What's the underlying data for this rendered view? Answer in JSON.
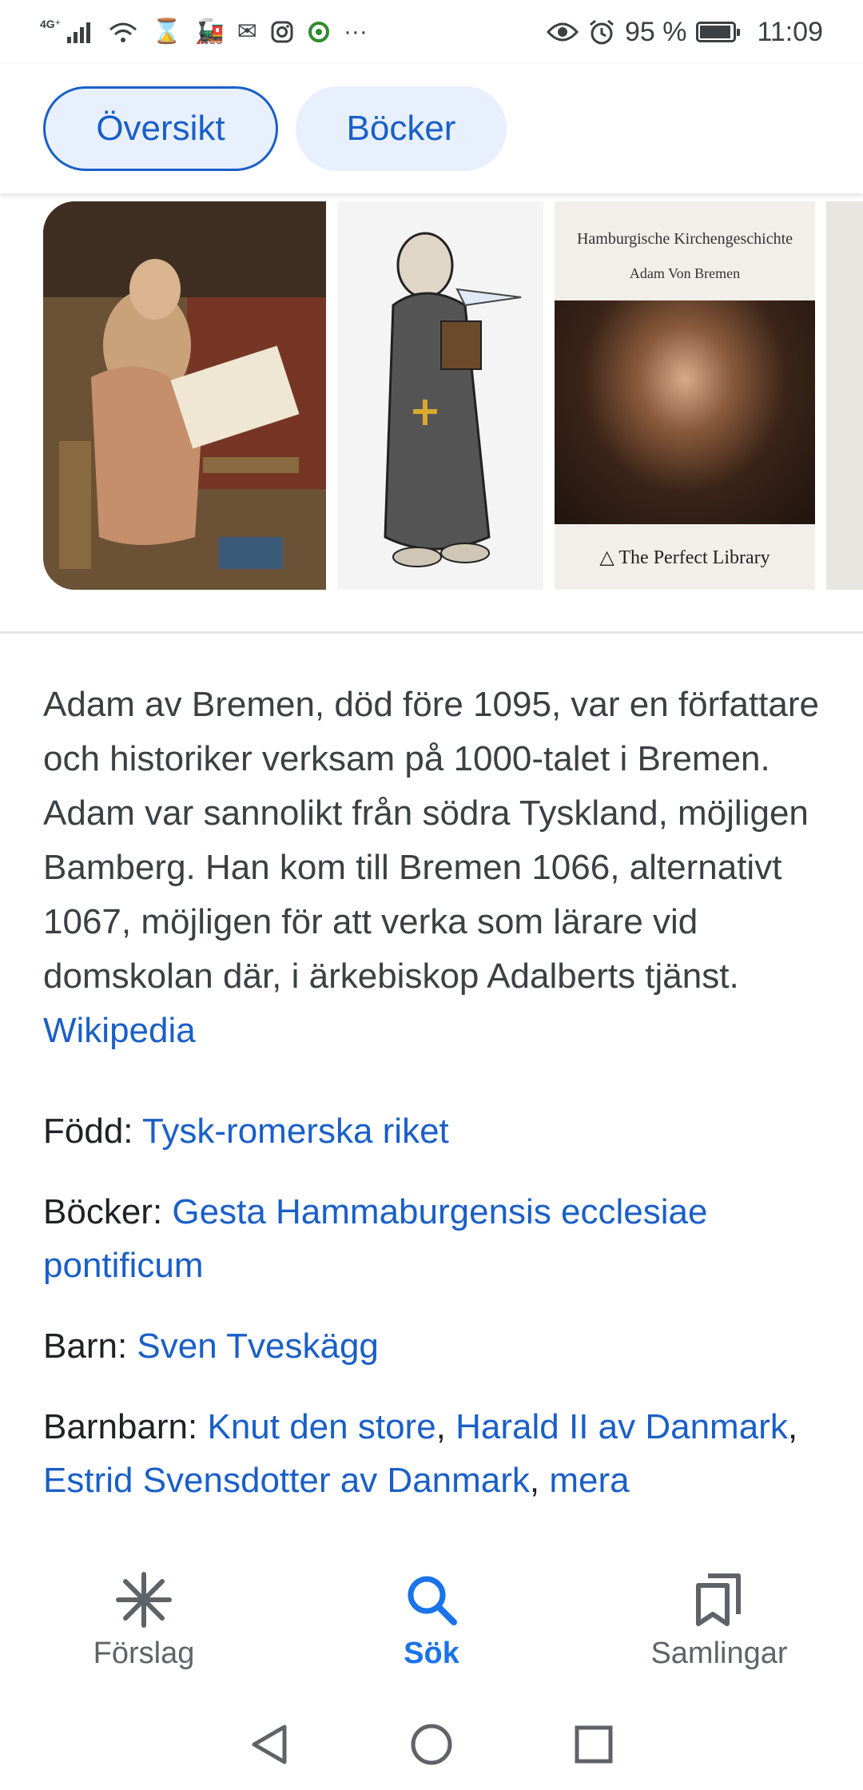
{
  "status_bar": {
    "network": "4G⁺",
    "battery_percent": "95 %",
    "battery_level": 0.95,
    "time": "11:09",
    "more_glyph": "···"
  },
  "tabs": [
    {
      "label": "Översikt",
      "active": true
    },
    {
      "label": "Böcker",
      "active": false
    }
  ],
  "images": {
    "book_cover": {
      "title": "Hamburgische Kirchengeschichte",
      "author": "Adam Von Bremen",
      "publisher": "The Perfect Library"
    }
  },
  "description": {
    "text": "Adam av Bremen, död före 1095, var en författare och historiker verksam på 1000-talet i Bremen. Adam var sannolikt från södra Tyskland, möjligen Bamberg. Han kom till Bremen 1066, alternativt 1067, möjligen för att verka som lärare vid domskolan där, i ärkebiskop Adalberts tjänst.",
    "source_link": "Wikipedia"
  },
  "facts": {
    "born": {
      "label": "Född:",
      "value": "Tysk-romerska riket"
    },
    "books": {
      "label": "Böcker:",
      "value": "Gesta Hammaburgensis ecclesiae pontificum"
    },
    "children": {
      "label": "Barn:",
      "value": "Sven Tveskägg"
    },
    "grandchildren": {
      "label": "Barnbarn:",
      "values": [
        "Knut den store",
        "Harald II av Danmark",
        "Estrid Svensdotter av Danmark"
      ],
      "more": "mera"
    }
  },
  "bottom_nav": [
    {
      "label": "Förslag",
      "icon": "asterisk-icon",
      "active": false
    },
    {
      "label": "Sök",
      "icon": "search-icon",
      "active": true
    },
    {
      "label": "Samlingar",
      "icon": "bookmarks-icon",
      "active": false
    }
  ],
  "colors": {
    "accent": "#1a73e8",
    "link": "#1a5fc8",
    "chip_bg": "#e8f0fe",
    "text": "#202124"
  }
}
